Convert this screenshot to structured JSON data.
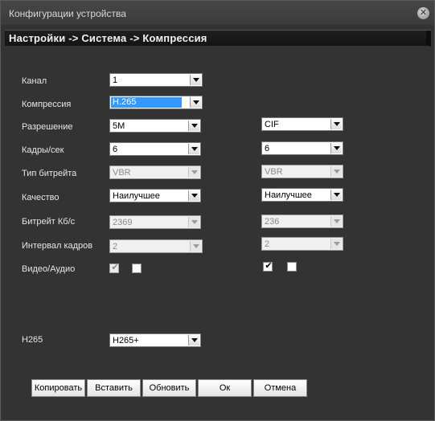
{
  "window": {
    "title": "Конфигурации устройства",
    "close_symbol": "✕"
  },
  "breadcrumb": "Настройки -> Система -> Компрессия",
  "fields": {
    "channel": {
      "label": "Канал",
      "value": "1"
    },
    "compression": {
      "label": "Компрессия",
      "value": "H.265"
    },
    "resolution": {
      "label": "Разрешение",
      "main": "5M",
      "extra": "CIF"
    },
    "fps": {
      "label": "Кадры/сек",
      "main": "6",
      "extra": "6"
    },
    "bitrate_type": {
      "label": "Тип битрейта",
      "main": "VBR",
      "extra": "VBR"
    },
    "quality": {
      "label": "Качество",
      "main": "Наилучшее",
      "extra": "Наилучшее"
    },
    "bitrate": {
      "label": "Битрейт Кб/с",
      "main": "2369",
      "extra": "236"
    },
    "gop": {
      "label": "Интервал кадров",
      "main": "2",
      "extra": "2"
    },
    "video_audio": {
      "label": "Видео/Аудио",
      "main_video": true,
      "main_audio": false,
      "extra_video": true,
      "extra_audio": false
    },
    "h265": {
      "label": "H265",
      "value": "H265+"
    }
  },
  "buttons": {
    "copy": "Копировать",
    "paste": "Вставить",
    "refresh": "Обновить",
    "ok": "Ок",
    "cancel": "Отмена"
  },
  "check_symbol": "✔",
  "icons": {
    "close": "close-icon",
    "dropdown": "chevron-down-icon"
  }
}
